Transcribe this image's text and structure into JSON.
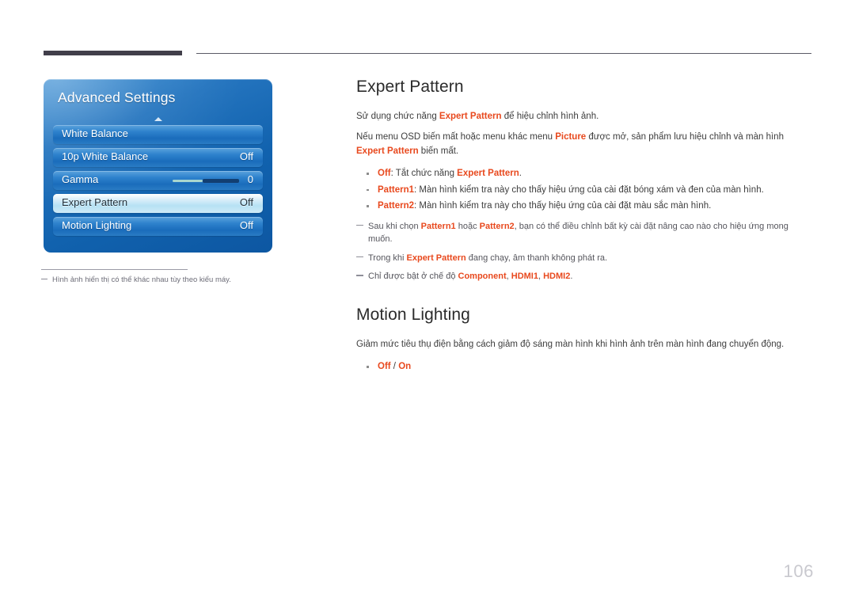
{
  "page": {
    "number": "106",
    "osd_caption": "Hình ảnh hiển thị có thể khác nhau tùy theo kiểu máy."
  },
  "osd": {
    "title": "Advanced Settings",
    "scroll_up_icon": "triangle-up-icon",
    "rows": [
      {
        "label": "White Balance",
        "value": "",
        "selected": false,
        "type": "menu"
      },
      {
        "label": "10p White Balance",
        "value": "Off",
        "selected": false,
        "type": "toggle"
      },
      {
        "label": "Gamma",
        "value": "0",
        "selected": false,
        "type": "slider"
      },
      {
        "label": "Expert Pattern",
        "value": "Off",
        "selected": true,
        "type": "toggle"
      },
      {
        "label": "Motion Lighting",
        "value": "Off",
        "selected": false,
        "type": "toggle"
      }
    ]
  },
  "sections": [
    {
      "title": "Expert Pattern",
      "paragraph_1": {
        "a": "Sử dụng chức năng ",
        "em1": "Expert Pattern",
        "b": " để hiệu chỉnh hình ảnh."
      },
      "paragraph_2": {
        "a": "Nếu menu OSD biến mất hoặc menu khác menu ",
        "em1": "Picture",
        "b": " được mở, sản phẩm lưu hiệu chỉnh và màn hình ",
        "em2": "Expert Pattern",
        "c": " biến mất."
      },
      "bullets": [
        {
          "em1": "Off",
          "a": ": Tắt chức năng ",
          "em2": "Expert Pattern",
          "b": "."
        },
        {
          "em1": "Pattern1",
          "a": ": Màn hình kiểm tra này cho thấy hiệu ứng của cài đặt bóng xám và đen của màn hình.",
          "em2": "",
          "b": ""
        },
        {
          "em1": "Pattern2",
          "a": ": Màn hình kiểm tra này cho thấy hiệu ứng của cài đặt màu sắc màn hình.",
          "em2": "",
          "b": ""
        }
      ],
      "notes": [
        {
          "a": "Sau khi chọn ",
          "em1": "Pattern1",
          "b": " hoặc ",
          "em2": "Pattern2",
          "c": ", bạn có thể điều chỉnh bất kỳ cài đặt nâng cao nào cho hiệu ứng mong muốn."
        },
        {
          "a": "Trong khi ",
          "em1": "Expert Pattern",
          "b": " đang chạy, âm thanh không phát ra.",
          "em2": "",
          "c": ""
        },
        {
          "a": "Chỉ được bật ở chế độ ",
          "em1": "Component",
          "b": ", ",
          "em2": "HDMI1",
          "c": ", ",
          "em3": "HDMI2",
          "d": "."
        }
      ]
    },
    {
      "title": "Motion Lighting",
      "paragraph_1": {
        "a": "Giảm mức tiêu thụ điện bằng cách giảm độ sáng màn hình khi hình ảnh trên màn hình đang chuyển động.",
        "em1": "",
        "b": ""
      },
      "bullets": [
        {
          "em1": "Off",
          "a": " / ",
          "em2": "On",
          "b": ""
        }
      ]
    }
  ],
  "colors": {
    "accent": "#e8491e",
    "osd_blue": "#1f6fba",
    "header_bar": "#413e4a",
    "page_number": "#c9c9cf"
  }
}
